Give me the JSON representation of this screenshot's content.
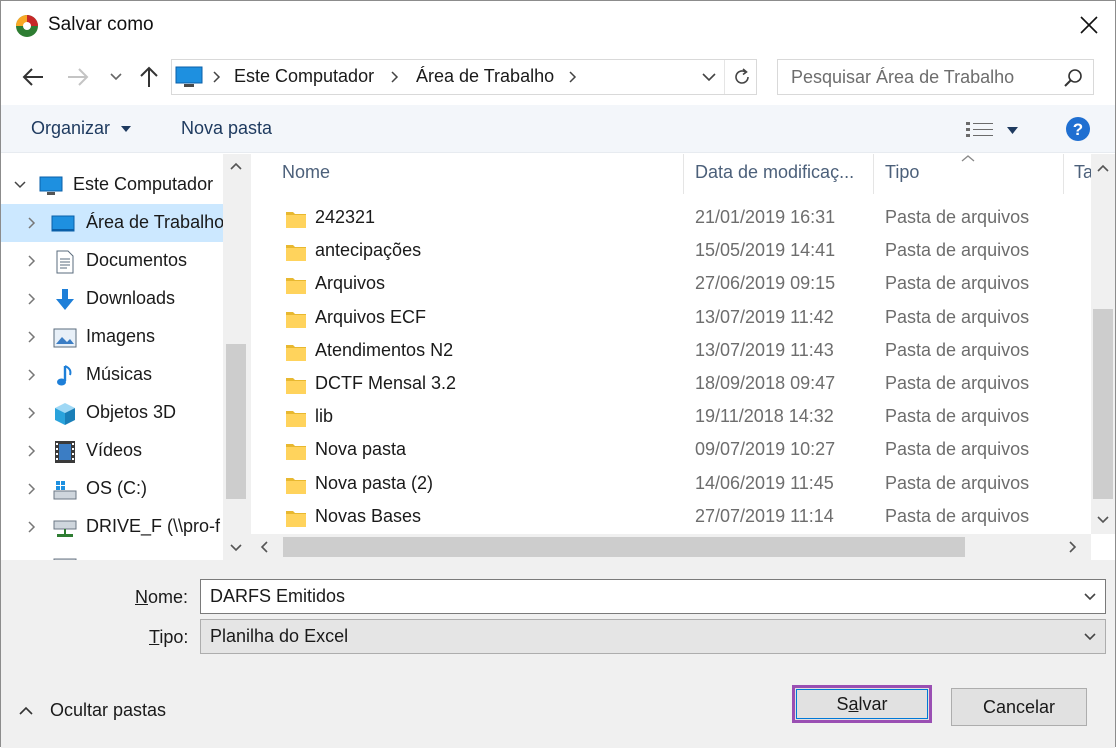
{
  "window": {
    "title": "Salvar como"
  },
  "address": {
    "crumbs": [
      "Este Computador",
      "Área de Trabalho"
    ],
    "search_placeholder": "Pesquisar Área de Trabalho"
  },
  "toolbar": {
    "organize_label": "Organizar",
    "new_folder_label": "Nova pasta"
  },
  "nav": {
    "items": [
      {
        "label": "Este Computador",
        "icon": "computer-icon"
      },
      {
        "label": "Área de Trabalho",
        "icon": "desktop-icon"
      },
      {
        "label": "Documentos",
        "icon": "documents-icon"
      },
      {
        "label": "Downloads",
        "icon": "download-icon"
      },
      {
        "label": "Imagens",
        "icon": "pictures-icon"
      },
      {
        "label": "Músicas",
        "icon": "music-icon"
      },
      {
        "label": "Objetos 3D",
        "icon": "cube-icon"
      },
      {
        "label": "Vídeos",
        "icon": "video-icon"
      },
      {
        "label": "OS (C:)",
        "icon": "drive-icon"
      },
      {
        "label": "DRIVE_F (\\\\pro-f",
        "icon": "network-drive-icon"
      }
    ]
  },
  "files": {
    "columns": [
      "Nome",
      "Data de modificaç...",
      "Tipo",
      "Ta"
    ],
    "rows": [
      {
        "name": "242321",
        "date": "21/01/2019 16:31",
        "type": "Pasta de arquivos"
      },
      {
        "name": "antecipações",
        "date": "15/05/2019 14:41",
        "type": "Pasta de arquivos"
      },
      {
        "name": "Arquivos",
        "date": "27/06/2019 09:15",
        "type": "Pasta de arquivos"
      },
      {
        "name": "Arquivos ECF",
        "date": "13/07/2019 11:42",
        "type": "Pasta de arquivos"
      },
      {
        "name": "Atendimentos N2",
        "date": "13/07/2019 11:43",
        "type": "Pasta de arquivos"
      },
      {
        "name": "DCTF Mensal 3.2",
        "date": "18/09/2018 09:47",
        "type": "Pasta de arquivos"
      },
      {
        "name": "lib",
        "date": "19/11/2018 14:32",
        "type": "Pasta de arquivos"
      },
      {
        "name": "Nova pasta",
        "date": "09/07/2019 10:27",
        "type": "Pasta de arquivos"
      },
      {
        "name": "Nova pasta (2)",
        "date": "14/06/2019 11:45",
        "type": "Pasta de arquivos"
      },
      {
        "name": "Novas Bases",
        "date": "27/07/2019 11:14",
        "type": "Pasta de arquivos"
      }
    ]
  },
  "form": {
    "name_label_u": "N",
    "name_label_rest": "ome:",
    "name_value": "DARFS Emitidos",
    "type_label_u": "T",
    "type_label_rest": "ipo:",
    "type_value": "Planilha do Excel"
  },
  "footer": {
    "hide_folders_label": "Ocultar pastas",
    "save_label_pre": "S",
    "save_label_u": "a",
    "save_label_post": "lvar",
    "cancel_label": "Cancelar"
  },
  "colors": {
    "accent": "#0078d7",
    "selection": "#cce8ff",
    "focus_highlight": "#9a4fb3",
    "folder": "#ffd35c"
  }
}
